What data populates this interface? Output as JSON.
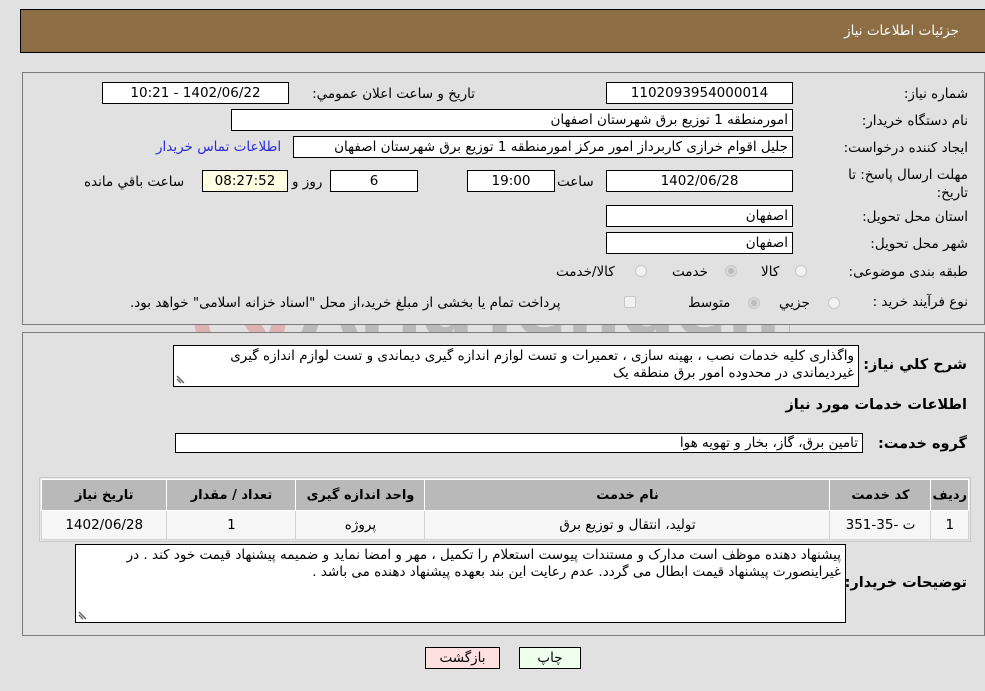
{
  "header": {
    "title": "جزئیات اطلاعات نیاز"
  },
  "form": {
    "need_number": {
      "label": "شماره نیاز:",
      "value": "1102093954000014"
    },
    "announce_datetime": {
      "label": "تاریخ و ساعت اعلان عمومي:",
      "value": "1402/06/22 - 10:21"
    },
    "buyer_org": {
      "label": "نام دستگاه خريدار:",
      "value": "امورمنطقه 1 توزیع برق شهرستان اصفهان"
    },
    "requester": {
      "label": "ایجاد کننده درخواست:",
      "value": "جلیل اقوام خرازی کاربرداز امور مرکز امورمنطقه 1 توزیع برق شهرستان اصفهان"
    },
    "contact_link": "اطلاعات تماس خریدار",
    "deadline": {
      "label": "مهلت ارسال پاسخ: تا تاریخ:",
      "date": "1402/06/28",
      "time_label": "ساعت",
      "time": "19:00",
      "days": "6",
      "days_label": "روز و",
      "remaining": "08:27:52",
      "remaining_label": "ساعت باقي مانده"
    },
    "delivery_province": {
      "label": "استان محل تحویل:",
      "value": "اصفهان"
    },
    "delivery_city": {
      "label": "شهر محل تحویل:",
      "value": "اصفهان"
    },
    "category": {
      "label": "طبقه بندی موضوعی:",
      "options": [
        "کالا",
        "خدمت",
        "کالا/خدمت"
      ],
      "selected": "خدمت"
    },
    "purchase_type": {
      "label": "نوع فرآیند خرید :",
      "options": [
        "جزيي",
        "متوسط"
      ],
      "selected": "متوسط",
      "treasury_note": "پرداخت تمام یا بخشی از مبلغ خرید،از محل \"اسناد خزانه اسلامی\" خواهد بود."
    }
  },
  "description": {
    "label": "شرح کلي نياز:",
    "value": "واگذاری کلیه خدمات نصب ، بهینه سازی ، تعمیرات و تست لوازم اندازه گیری دیماندی و تست لوازم اندازه گیری غیردیماندی در محدوده امور برق منطقه یک"
  },
  "services": {
    "section_title": "اطلاعات خدمات مورد نیاز",
    "group_label": "گروه خدمت:",
    "group_value": "تامین برق، گاز، بخار و تهویه هوا",
    "table": {
      "headers": [
        "ردیف",
        "کد خدمت",
        "نام خدمت",
        "واحد اندازه گیری",
        "تعداد / مقدار",
        "تاریخ نیاز"
      ],
      "rows": [
        [
          "1",
          "ت -35-351",
          "تولید، انتقال و توزیع برق",
          "پروژه",
          "1",
          "1402/06/28"
        ]
      ]
    }
  },
  "buyer_notes": {
    "label": "توضیحات خریدار:",
    "value": "پیشنهاد دهنده موظف است مدارک و مستندات پیوست استعلام را تکمیل ، مهر و امضا نماید و ضمیمه پیشنهاد قیمت خود کند . در غیراینصورت پیشنهاد قیمت ابطال می گردد. عدم رعایت این بند بعهده پیشنهاد دهنده می باشد ."
  },
  "buttons": {
    "print": "چاپ",
    "back": "بازگشت"
  },
  "watermark": "AriaTender.neT",
  "colors": {
    "header_bg": "#8c6d44",
    "print_bg": "#eeffee",
    "back_bg": "#ffe0e0",
    "link": "#2b2bd6"
  }
}
